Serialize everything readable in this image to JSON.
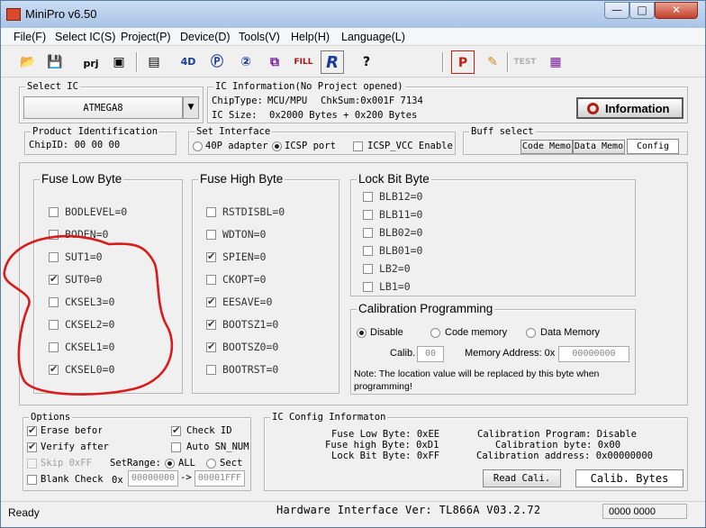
{
  "window": {
    "title": "MiniPro v6.50",
    "controls": [
      "—",
      "□",
      "✕"
    ]
  },
  "menu": [
    "File(F)",
    "Select IC(S)",
    "Project(P)",
    "Device(D)",
    "Tools(V)",
    "Help(H)",
    "Language(L)"
  ],
  "toolbar": {
    "buttons": [
      "open",
      "save",
      "prj",
      "image",
      "read-chip",
      "4D",
      "verify",
      "blank",
      "erase",
      "fill",
      "R",
      "?",
      "P",
      "edit",
      "TEST",
      "chip"
    ]
  },
  "select_ic": {
    "legend": "Select IC",
    "value": "ATMEGA8"
  },
  "ic_info": {
    "legend": "IC Information(No Project opened)",
    "chiptype_label": "ChipType:",
    "chiptype": "MCU/MPU",
    "chksum": "ChkSum:0x001F 7134",
    "size_label": "IC Size:",
    "size": "0x2000 Bytes + 0x200 Bytes",
    "info_button": "Information"
  },
  "product_id": {
    "legend": "Product Identification",
    "chip_id": "ChipID: 00 00 00"
  },
  "interface": {
    "legend": "Set Interface",
    "opt1": "40P adapter",
    "opt2": "ICSP port",
    "icsp_vcc": "ICSP_VCC Enable"
  },
  "buff": {
    "legend": "Buff select",
    "tabs": [
      "Code Memo",
      "Data Memo",
      "Config"
    ]
  },
  "fuse_low": {
    "legend": "Fuse Low Byte",
    "items": [
      {
        "label": "BODLEVEL=0",
        "checked": false
      },
      {
        "label": "BODEN=0",
        "checked": false
      },
      {
        "label": "SUT1=0",
        "checked": false
      },
      {
        "label": "SUT0=0",
        "checked": true
      },
      {
        "label": "CKSEL3=0",
        "checked": false
      },
      {
        "label": "CKSEL2=0",
        "checked": false
      },
      {
        "label": "CKSEL1=0",
        "checked": false
      },
      {
        "label": "CKSEL0=0",
        "checked": true
      }
    ]
  },
  "fuse_high": {
    "legend": "Fuse High Byte",
    "items": [
      {
        "label": "RSTDISBL=0",
        "checked": false
      },
      {
        "label": "WDTON=0",
        "checked": false
      },
      {
        "label": "SPIEN=0",
        "checked": true
      },
      {
        "label": "CKOPT=0",
        "checked": false
      },
      {
        "label": "EESAVE=0",
        "checked": true
      },
      {
        "label": "BOOTSZ1=0",
        "checked": true
      },
      {
        "label": "BOOTSZ0=0",
        "checked": true
      },
      {
        "label": "BOOTRST=0",
        "checked": false
      }
    ]
  },
  "lock_bits": {
    "legend": "Lock Bit Byte",
    "items": [
      {
        "label": "BLB12=0",
        "checked": false
      },
      {
        "label": "BLB11=0",
        "checked": false
      },
      {
        "label": "BLB02=0",
        "checked": false
      },
      {
        "label": "BLB01=0",
        "checked": false
      },
      {
        "label": "LB2=0",
        "checked": false
      },
      {
        "label": "LB1=0",
        "checked": false
      }
    ]
  },
  "calibration": {
    "legend": "Calibration Programming",
    "disable": "Disable",
    "code_memory": "Code memory",
    "data_memory": "Data Memory",
    "calib_label": "Calib.",
    "calib_value": "00",
    "mem_addr_label": "Memory Address: 0x",
    "mem_addr_value": "00000000",
    "note": "Note: The location value will be replaced by this byte  when programming!"
  },
  "options": {
    "legend": "Options",
    "erase": "Erase befor",
    "verify": "Verify after",
    "skip": "Skip 0xFF",
    "blank": "Blank Check",
    "check_id": "Check ID",
    "auto_sn": "Auto SN_NUM",
    "set_range": "SetRange:",
    "all": "ALL",
    "sect": "Sect",
    "ox": "0x",
    "range_from": "00000000",
    "arrow": "->",
    "range_to": "00001FFF"
  },
  "ic_config": {
    "legend": "IC Config Informaton",
    "fuse_low": "Fuse Low Byte: 0xEE",
    "fuse_high": "Fuse high Byte: 0xD1",
    "lock_bit": "Lock Bit Byte: 0xFF",
    "calib_program": "Calibration Program: Disable",
    "calib_byte": "Calibration byte: 0x00",
    "calib_address": "Calibration address: 0x00000000",
    "read_cali": "Read Cali.",
    "calib_bytes": "Calib. Bytes"
  },
  "status": {
    "left": "Ready",
    "hw": "Hardware Interface Ver: TL866A V03.2.72",
    "right": "0000 0000"
  }
}
